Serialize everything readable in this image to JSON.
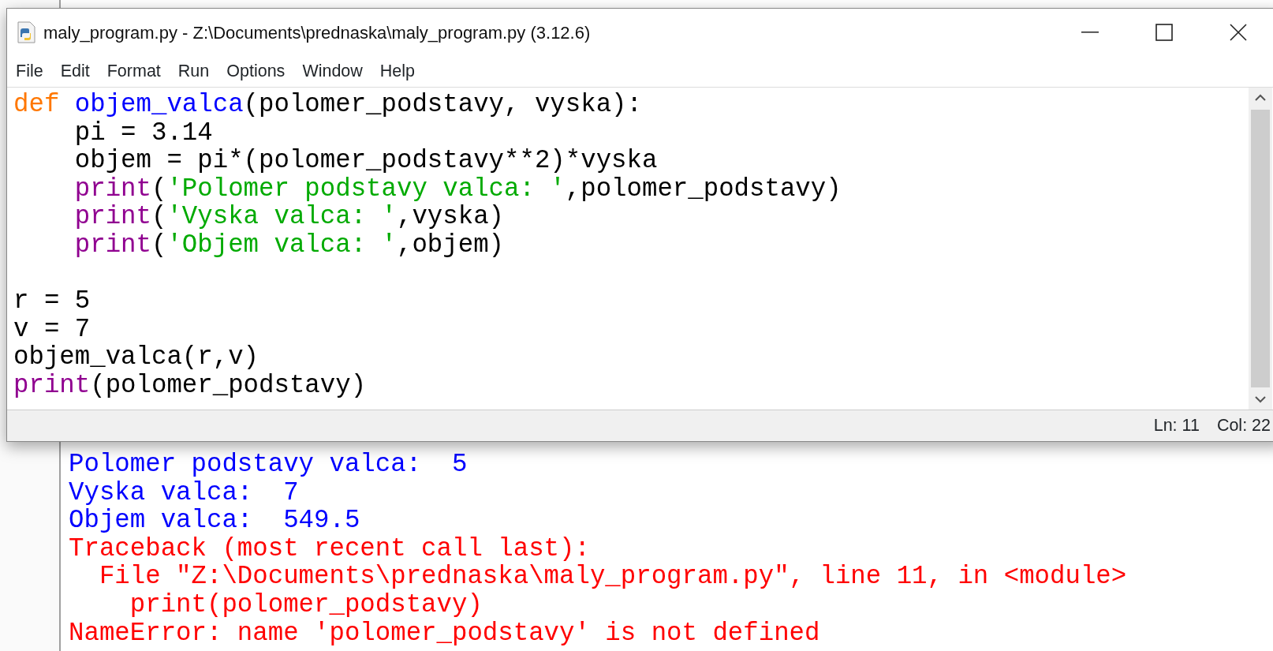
{
  "editor": {
    "title": "maly_program.py - Z:\\Documents\\prednaska\\maly_program.py (3.12.6)",
    "menu": [
      "File",
      "Edit",
      "Format",
      "Run",
      "Options",
      "Window",
      "Help"
    ],
    "code": [
      {
        "indented": false,
        "blank_after": false,
        "tokens": [
          {
            "kind": "keyword",
            "text": "def"
          },
          {
            "kind": "definition",
            "text": "objem_valca"
          },
          {
            "kind": "plain",
            "text": "(polomer_podstavy, vyska):"
          }
        ]
      },
      {
        "indented": true,
        "blank_after": false,
        "tokens": [
          {
            "kind": "plain",
            "text": "pi = 3.14"
          }
        ]
      },
      {
        "indented": true,
        "blank_after": false,
        "tokens": [
          {
            "kind": "plain",
            "text": "objem = pi*(polomer_podstavy**2)*vyska"
          }
        ]
      },
      {
        "indented": true,
        "blank_after": false,
        "tokens": [
          {
            "kind": "builtin",
            "text": "print"
          },
          {
            "kind": "plain",
            "text": "("
          },
          {
            "kind": "string",
            "text": "'Polomer podstavy valca: '"
          },
          {
            "kind": "plain",
            "text": ",polomer_podstavy)"
          }
        ]
      },
      {
        "indented": true,
        "blank_after": false,
        "tokens": [
          {
            "kind": "builtin",
            "text": "print"
          },
          {
            "kind": "plain",
            "text": "("
          },
          {
            "kind": "string",
            "text": "'Vyska valca: '"
          },
          {
            "kind": "plain",
            "text": ",vyska)"
          }
        ]
      },
      {
        "indented": true,
        "blank_after": true,
        "tokens": [
          {
            "kind": "builtin",
            "text": "print"
          },
          {
            "kind": "plain",
            "text": "("
          },
          {
            "kind": "string",
            "text": "'Objem valca: '"
          },
          {
            "kind": "plain",
            "text": ",objem)"
          }
        ]
      },
      {
        "indented": false,
        "blank_after": false,
        "tokens": [
          {
            "kind": "plain",
            "text": "r = 5"
          }
        ]
      },
      {
        "indented": false,
        "blank_after": false,
        "tokens": [
          {
            "kind": "plain",
            "text": "v = 7"
          }
        ]
      },
      {
        "indented": false,
        "blank_after": false,
        "tokens": [
          {
            "kind": "plain",
            "text": "objem_valca(r,v)"
          }
        ]
      },
      {
        "indented": false,
        "blank_after": false,
        "tokens": [
          {
            "kind": "builtin",
            "text": "print"
          },
          {
            "kind": "plain",
            "text": "(polomer_podstavy)"
          }
        ]
      }
    ],
    "status": {
      "line": "Ln: 11",
      "column": "Col: 22"
    }
  },
  "shell": {
    "lines": [
      {
        "kind": "output",
        "text": "Polomer podstavy valca:  5"
      },
      {
        "kind": "output",
        "text": "Vyska valca:  7"
      },
      {
        "kind": "output",
        "text": "Objem valca:  549.5"
      },
      {
        "kind": "error",
        "text": "Traceback (most recent call last):"
      },
      {
        "kind": "error",
        "text": "  File \"Z:\\Documents\\prednaska\\maly_program.py\", line 11, in <module>"
      },
      {
        "kind": "error",
        "text": "    print(polomer_podstavy)"
      },
      {
        "kind": "error",
        "text": "NameError: name 'polomer_podstavy' is not defined"
      }
    ]
  }
}
